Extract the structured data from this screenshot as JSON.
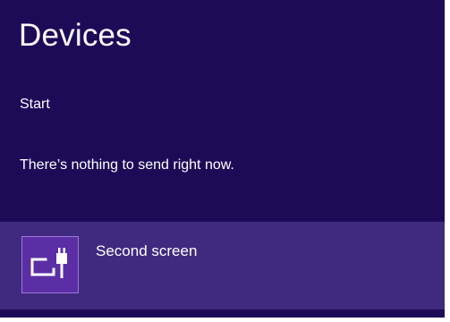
{
  "panel": {
    "title": "Devices",
    "subtitle": "Start",
    "message": "There’s nothing to send right now.",
    "background_color": "#1e0b58"
  },
  "devices": [
    {
      "label": "Second screen",
      "icon": "second-screen-icon",
      "tile_color": "#5b2ea5",
      "row_color": "#3f2a7f"
    }
  ]
}
